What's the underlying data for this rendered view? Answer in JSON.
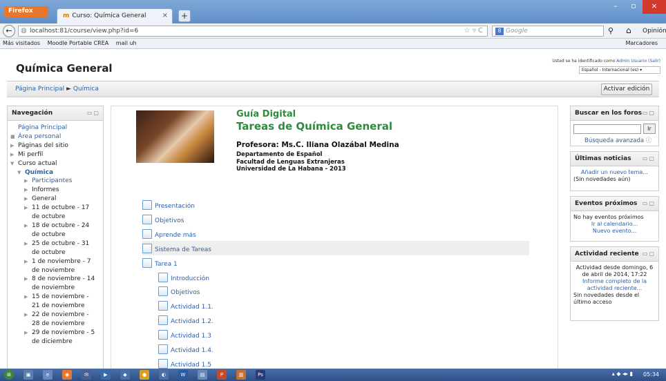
{
  "browser": {
    "menu_button": "Firefox",
    "tab_title": "Curso: Química General",
    "url": "localhost:81/course/view.php?id=6",
    "search_placeholder": "Google",
    "right_label": "Opinión",
    "bookmarks": [
      "Más visitados",
      "Moodle Portable CREA",
      "mail uh"
    ],
    "bookmarks_right": "Marcadores"
  },
  "header": {
    "site_title": "Química General",
    "login_text": "Usted se ha identificado como ",
    "login_user": "Admin Usuario (Salir)",
    "language": "Español - Internacional (es)"
  },
  "breadcrumb": {
    "home": "Página Principal",
    "separator": "►",
    "current": "Química",
    "edit_button": "Activar edición"
  },
  "navigation": {
    "title": "Navegación",
    "items": [
      {
        "label": "Página Principal",
        "link": true,
        "indent": 0,
        "marker": ""
      },
      {
        "label": "Área personal",
        "link": true,
        "indent": 0,
        "marker": "■"
      },
      {
        "label": "Páginas del sitio",
        "link": false,
        "indent": 0,
        "marker": "▶"
      },
      {
        "label": "Mi perfil",
        "link": false,
        "indent": 0,
        "marker": "▶"
      },
      {
        "label": "Curso actual",
        "link": false,
        "indent": 0,
        "marker": "▼"
      },
      {
        "label": "Química",
        "link": true,
        "indent": 1,
        "marker": "▼",
        "bold": true
      },
      {
        "label": "Participantes",
        "link": true,
        "indent": 2,
        "marker": "▶"
      },
      {
        "label": "Informes",
        "link": false,
        "indent": 2,
        "marker": "▶"
      },
      {
        "label": "General",
        "link": false,
        "indent": 2,
        "marker": "▶"
      },
      {
        "label": "11 de octubre - 17",
        "label2": "de octubre",
        "link": false,
        "indent": 2,
        "marker": "▶"
      },
      {
        "label": "18 de octubre - 24",
        "label2": "de octubre",
        "link": false,
        "indent": 2,
        "marker": "▶"
      },
      {
        "label": "25 de octubre - 31",
        "label2": "de octubre",
        "link": false,
        "indent": 2,
        "marker": "▶"
      },
      {
        "label": "1 de noviembre - 7",
        "label2": "de noviembre",
        "link": false,
        "indent": 2,
        "marker": "▶"
      },
      {
        "label": "8 de noviembre - 14",
        "label2": "de noviembre",
        "link": false,
        "indent": 2,
        "marker": "▶"
      },
      {
        "label": "15 de noviembre -",
        "label2": "21 de noviembre",
        "link": false,
        "indent": 2,
        "marker": "▶"
      },
      {
        "label": "22 de noviembre -",
        "label2": "28 de noviembre",
        "link": false,
        "indent": 2,
        "marker": "▶"
      },
      {
        "label": "29 de noviembre - 5",
        "label2": "de diciembre",
        "link": false,
        "indent": 2,
        "marker": "▶"
      }
    ]
  },
  "banner": {
    "title": "Guía Digital",
    "subtitle": "Tareas de Química General",
    "professor": "Profesora: Ms.C. Iliana Olazábal Medina",
    "dept1": "Departamento de Español",
    "dept2": "Facultad de Lenguas Extranjeras",
    "dept3": "Universidad de La Habana - 2013"
  },
  "resources": [
    {
      "label": "Presentación",
      "level": 1
    },
    {
      "label": "Objetivos",
      "level": 1
    },
    {
      "label": "Aprende más",
      "level": 1
    },
    {
      "label": "Sistema de Tareas",
      "level": 1,
      "highlight": true
    },
    {
      "label": "Tarea 1",
      "level": 1
    },
    {
      "label": "Introducción",
      "level": 2
    },
    {
      "label": "Objetivos",
      "level": 2
    },
    {
      "label": "Actividad 1.1.",
      "level": 2
    },
    {
      "label": "Actividad 1.2.",
      "level": 2
    },
    {
      "label": "Actividad 1.3",
      "level": 2
    },
    {
      "label": "Actividad 1.4.",
      "level": 2
    },
    {
      "label": "Actividad 1.5",
      "level": 2
    }
  ],
  "forum_search": {
    "title": "Buscar en los foros",
    "button": "Ir",
    "advanced": "Búsqueda avanzada"
  },
  "news": {
    "title": "Últimas noticias",
    "add": "Añadir un nuevo tema...",
    "none": "(Sin novedades aún)"
  },
  "events": {
    "title": "Eventos próximos",
    "none": "No hay eventos próximos",
    "calendar": "Ir al calendario...",
    "new": "Nuevo evento..."
  },
  "activity": {
    "title": "Actividad reciente",
    "since": "Actividad desde domingo, 6 de abril de 2014, 17:22",
    "report": "Informe completo de la actividad reciente...",
    "none": "Sin novedades desde el último acceso"
  },
  "taskbar": {
    "clock": "05:34"
  }
}
